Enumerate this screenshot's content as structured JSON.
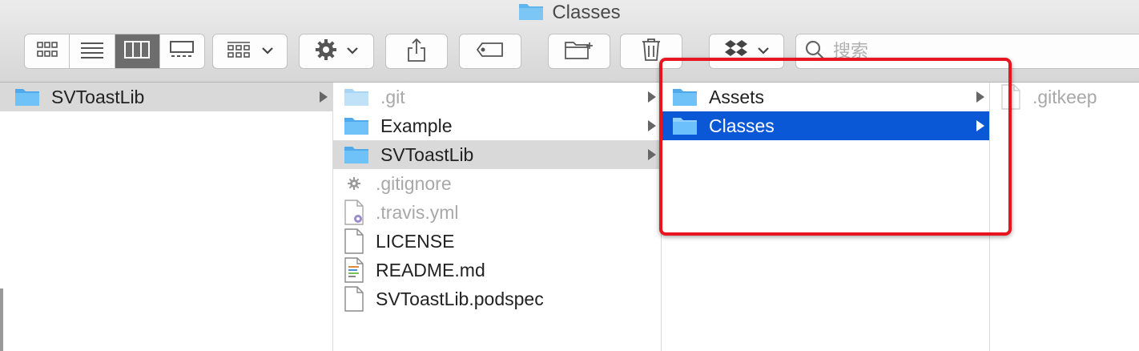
{
  "window": {
    "title": "Classes"
  },
  "toolbar": {
    "view_modes": [
      "icon-view-icon",
      "list-view-icon",
      "column-view-icon",
      "gallery-view-icon"
    ],
    "active_view": 2,
    "search_placeholder": "搜索"
  },
  "columns": [
    {
      "items": [
        {
          "name": "SVToastLib",
          "type": "folder",
          "state": "gray",
          "arrow": true
        }
      ]
    },
    {
      "items": [
        {
          "name": ".git",
          "type": "folder-dim",
          "state": "dim",
          "arrow": true
        },
        {
          "name": "Example",
          "type": "folder",
          "state": "",
          "arrow": true
        },
        {
          "name": "SVToastLib",
          "type": "folder",
          "state": "gray",
          "arrow": true
        },
        {
          "name": ".gitignore",
          "type": "gear-file",
          "state": "dim",
          "arrow": false
        },
        {
          "name": ".travis.yml",
          "type": "yml-file",
          "state": "dim",
          "arrow": false
        },
        {
          "name": "LICENSE",
          "type": "file",
          "state": "",
          "arrow": false
        },
        {
          "name": "README.md",
          "type": "text-file",
          "state": "",
          "arrow": false
        },
        {
          "name": "SVToastLib.podspec",
          "type": "file",
          "state": "",
          "arrow": false
        }
      ]
    },
    {
      "items": [
        {
          "name": "Assets",
          "type": "folder",
          "state": "",
          "arrow": true
        },
        {
          "name": "Classes",
          "type": "folder",
          "state": "sel",
          "arrow": true
        }
      ]
    },
    {
      "items": [
        {
          "name": ".gitkeep",
          "type": "file-dim",
          "state": "dim",
          "arrow": false
        }
      ]
    }
  ],
  "colors": {
    "selection": "#0a58d6",
    "highlight": "#e8141f",
    "folder": "#5fb5ee"
  }
}
